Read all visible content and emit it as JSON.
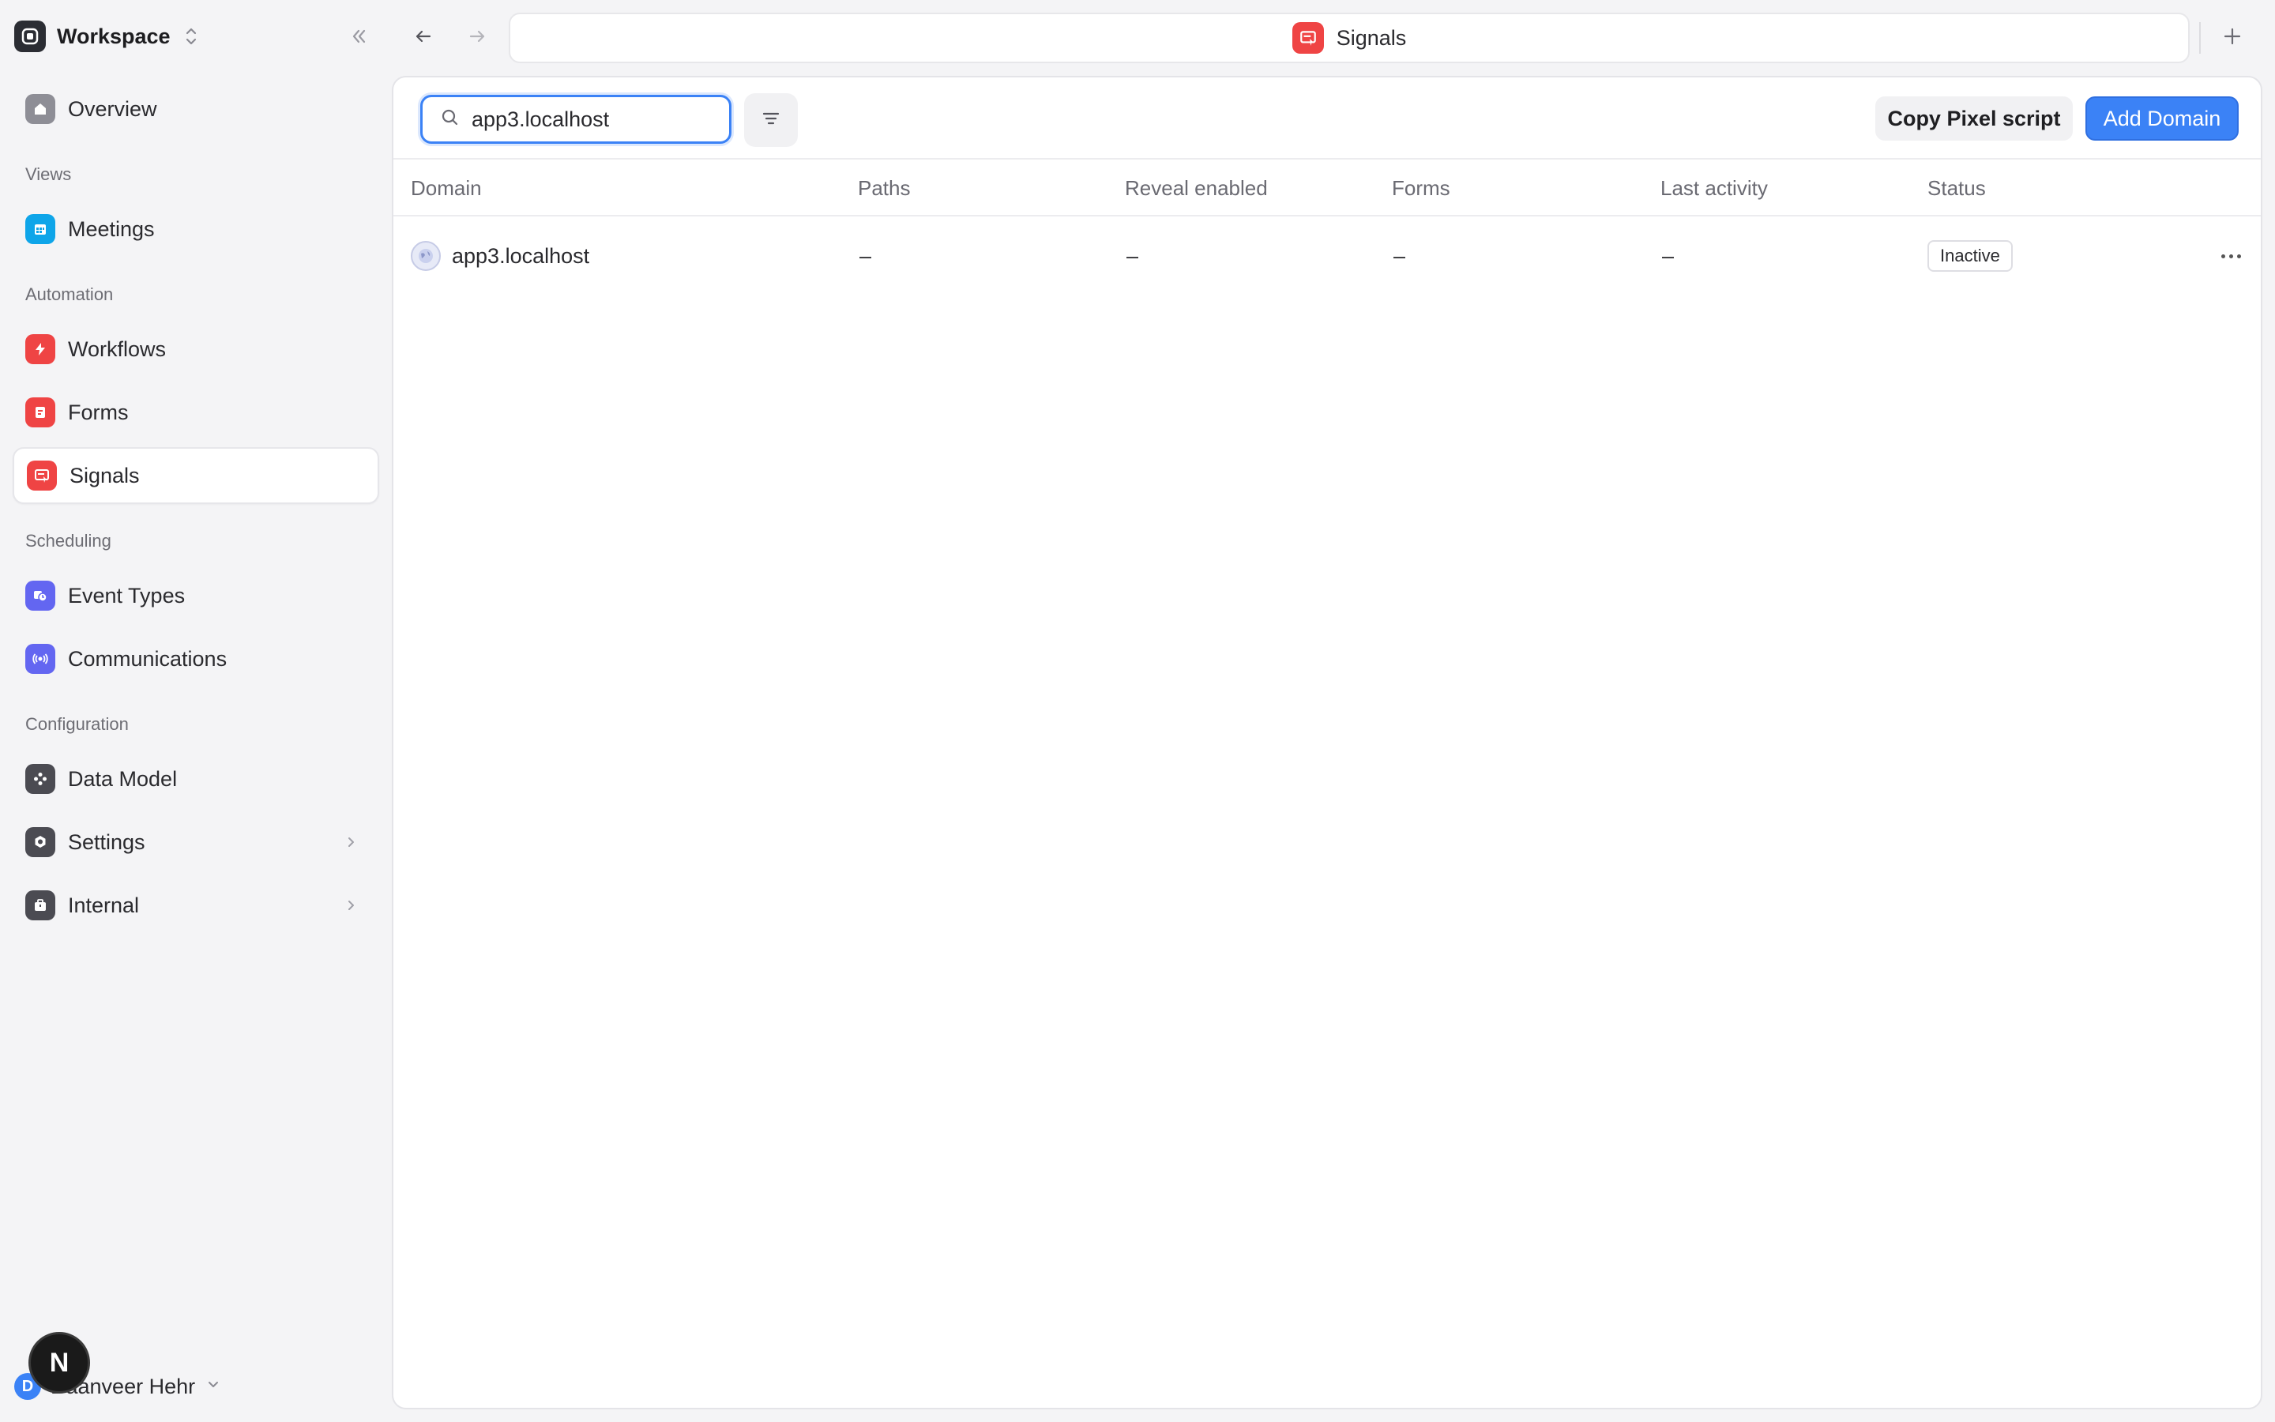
{
  "workspace": {
    "name": "Workspace"
  },
  "sidebar": {
    "overview": "Overview",
    "sections": {
      "views": "Views",
      "automation": "Automation",
      "scheduling": "Scheduling",
      "configuration": "Configuration"
    },
    "items": {
      "meetings": "Meetings",
      "workflows": "Workflows",
      "forms": "Forms",
      "signals": "Signals",
      "event_types": "Event Types",
      "communications": "Communications",
      "data_model": "Data Model",
      "settings": "Settings",
      "internal": "Internal"
    },
    "active_item": "Signals"
  },
  "user": {
    "initial": "D",
    "name": "Daanveer Hehr"
  },
  "dev_badge": "N",
  "tab": {
    "title": "Signals"
  },
  "toolbar": {
    "search_value": "app3.localhost",
    "copy_label": "Copy Pixel script",
    "add_label": "Add Domain"
  },
  "table": {
    "columns": [
      "Domain",
      "Paths",
      "Reveal enabled",
      "Forms",
      "Last activity",
      "Status"
    ],
    "rows": [
      {
        "domain": "app3.localhost",
        "paths": "–",
        "reveal_enabled": "–",
        "forms": "–",
        "last_activity": "–",
        "status": "Inactive"
      }
    ]
  },
  "colors": {
    "accent": "#3b82f6",
    "signals_icon": "#ef4444",
    "meetings_icon": "#0ea5e9",
    "event_types_icon": "#6366f1"
  },
  "icons": {
    "workspace": "workspace-logo-icon",
    "collapse": "double-chevron-left-icon",
    "back": "arrow-left-icon",
    "forward": "arrow-right-icon",
    "new_tab": "plus-icon",
    "search": "search-icon",
    "filter": "filter-icon",
    "row_domain": "globe-icon",
    "row_more": "more-horizontal-icon"
  }
}
